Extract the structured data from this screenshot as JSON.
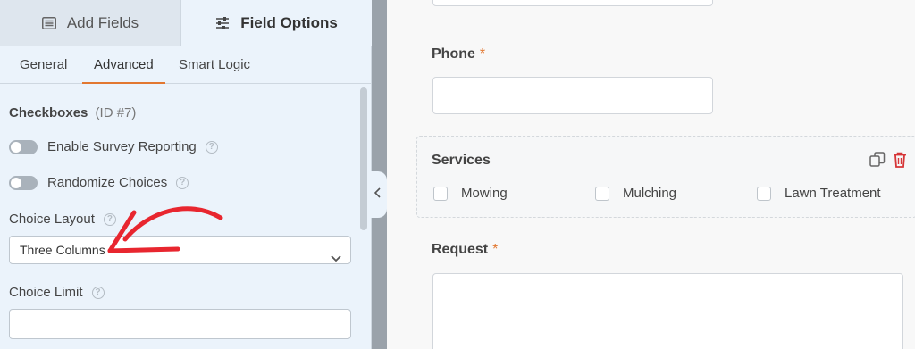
{
  "left_panel": {
    "tabs": {
      "add_fields": "Add Fields",
      "field_options": "Field Options"
    },
    "subtabs": [
      "General",
      "Advanced",
      "Smart Logic"
    ],
    "active_subtab": "Advanced",
    "field_title": "Checkboxes",
    "field_id": "(ID #7)",
    "toggles": [
      {
        "label": "Enable Survey Reporting",
        "on": false
      },
      {
        "label": "Randomize Choices",
        "on": false
      }
    ],
    "choice_layout": {
      "label": "Choice Layout",
      "value": "Three Columns"
    },
    "choice_limit": {
      "label": "Choice Limit",
      "value": ""
    },
    "help_glyph": "?"
  },
  "right_panel": {
    "phone_label": "Phone",
    "required_mark": "*",
    "services": {
      "title": "Services",
      "options": [
        "Mowing",
        "Mulching",
        "Lawn Treatment"
      ]
    },
    "request_label": "Request"
  },
  "colors": {
    "accent": "#e27730",
    "panel_bg": "#ebf3fb",
    "delete_red": "#d63638",
    "annotation_red": "#e8262f"
  },
  "icons": {
    "add_fields": "list-icon",
    "field_options": "sliders-icon",
    "collapse": "chevron-left-icon",
    "duplicate": "duplicate-icon",
    "delete": "trash-icon",
    "select": "chevron-down-icon"
  }
}
